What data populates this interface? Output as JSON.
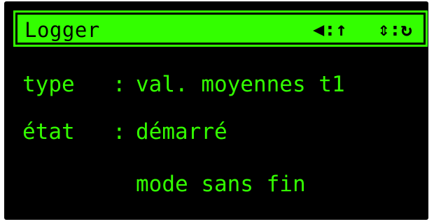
{
  "header": {
    "title": "Logger",
    "nav_left_icon": "arrow-left-up-icon",
    "nav_left_glyph": "◀:↑",
    "nav_right_icon": "updown-refresh-icon",
    "nav_right_glyph": "⇕:↻"
  },
  "rows": [
    {
      "label": "type",
      "separator": ":",
      "value": "val. moyennes t1"
    },
    {
      "label": "état",
      "separator": ":",
      "value": "démarré"
    },
    {
      "label": "",
      "separator": "",
      "value": "mode sans fin"
    }
  ],
  "colors": {
    "screen_background": "#000000",
    "text": "#33ff00",
    "header_background": "#33ff00",
    "header_text": "#000000"
  }
}
